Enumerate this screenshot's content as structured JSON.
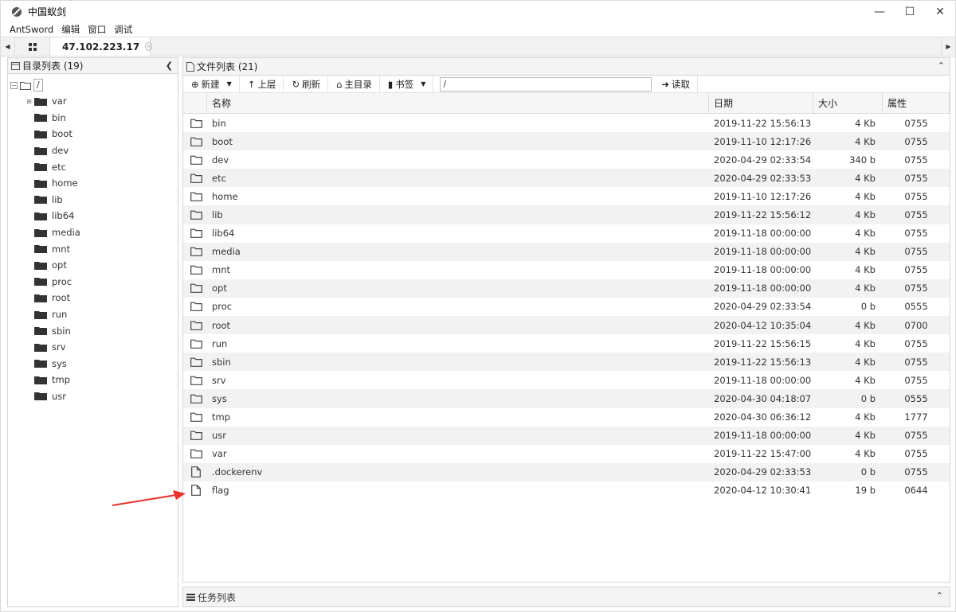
{
  "window": {
    "title": "中国蚁剑",
    "controls": {
      "minimize": "—",
      "maximize": "☐",
      "close": "✕"
    }
  },
  "menu": [
    "AntSword",
    "编辑",
    "窗口",
    "调试"
  ],
  "tabs": {
    "active_label": "47.102.223.17"
  },
  "left_panel": {
    "title": "目录列表 (19)",
    "root_label": "/",
    "items": [
      {
        "name": "var",
        "expandable": true
      },
      {
        "name": "bin"
      },
      {
        "name": "boot"
      },
      {
        "name": "dev"
      },
      {
        "name": "etc"
      },
      {
        "name": "home"
      },
      {
        "name": "lib"
      },
      {
        "name": "lib64"
      },
      {
        "name": "media"
      },
      {
        "name": "mnt"
      },
      {
        "name": "opt"
      },
      {
        "name": "proc"
      },
      {
        "name": "root"
      },
      {
        "name": "run"
      },
      {
        "name": "sbin"
      },
      {
        "name": "srv"
      },
      {
        "name": "sys"
      },
      {
        "name": "tmp"
      },
      {
        "name": "usr"
      }
    ]
  },
  "right_panel": {
    "title": "文件列表 (21)",
    "toolbar": {
      "new_label": "新建",
      "up_label": "上层",
      "refresh_label": "刷新",
      "home_label": "主目录",
      "bookmark_label": "书签",
      "path_value": "/",
      "read_label": "读取"
    },
    "columns": {
      "name": "名称",
      "date": "日期",
      "size": "大小",
      "attr": "属性"
    },
    "files": [
      {
        "type": "folder",
        "name": "bin",
        "date": "2019-11-22 15:56:13",
        "size": "4 Kb",
        "attr": "0755"
      },
      {
        "type": "folder",
        "name": "boot",
        "date": "2019-11-10 12:17:26",
        "size": "4 Kb",
        "attr": "0755"
      },
      {
        "type": "folder",
        "name": "dev",
        "date": "2020-04-29 02:33:54",
        "size": "340 b",
        "attr": "0755"
      },
      {
        "type": "folder",
        "name": "etc",
        "date": "2020-04-29 02:33:53",
        "size": "4 Kb",
        "attr": "0755"
      },
      {
        "type": "folder",
        "name": "home",
        "date": "2019-11-10 12:17:26",
        "size": "4 Kb",
        "attr": "0755"
      },
      {
        "type": "folder",
        "name": "lib",
        "date": "2019-11-22 15:56:12",
        "size": "4 Kb",
        "attr": "0755"
      },
      {
        "type": "folder",
        "name": "lib64",
        "date": "2019-11-18 00:00:00",
        "size": "4 Kb",
        "attr": "0755"
      },
      {
        "type": "folder",
        "name": "media",
        "date": "2019-11-18 00:00:00",
        "size": "4 Kb",
        "attr": "0755"
      },
      {
        "type": "folder",
        "name": "mnt",
        "date": "2019-11-18 00:00:00",
        "size": "4 Kb",
        "attr": "0755"
      },
      {
        "type": "folder",
        "name": "opt",
        "date": "2019-11-18 00:00:00",
        "size": "4 Kb",
        "attr": "0755"
      },
      {
        "type": "folder",
        "name": "proc",
        "date": "2020-04-29 02:33:54",
        "size": "0 b",
        "attr": "0555"
      },
      {
        "type": "folder",
        "name": "root",
        "date": "2020-04-12 10:35:04",
        "size": "4 Kb",
        "attr": "0700"
      },
      {
        "type": "folder",
        "name": "run",
        "date": "2019-11-22 15:56:15",
        "size": "4 Kb",
        "attr": "0755"
      },
      {
        "type": "folder",
        "name": "sbin",
        "date": "2019-11-22 15:56:13",
        "size": "4 Kb",
        "attr": "0755"
      },
      {
        "type": "folder",
        "name": "srv",
        "date": "2019-11-18 00:00:00",
        "size": "4 Kb",
        "attr": "0755"
      },
      {
        "type": "folder",
        "name": "sys",
        "date": "2020-04-30 04:18:07",
        "size": "0 b",
        "attr": "0555"
      },
      {
        "type": "folder",
        "name": "tmp",
        "date": "2020-04-30 06:36:12",
        "size": "4 Kb",
        "attr": "1777"
      },
      {
        "type": "folder",
        "name": "usr",
        "date": "2019-11-18 00:00:00",
        "size": "4 Kb",
        "attr": "0755"
      },
      {
        "type": "folder",
        "name": "var",
        "date": "2019-11-22 15:47:00",
        "size": "4 Kb",
        "attr": "0755"
      },
      {
        "type": "file",
        "name": ".dockerenv",
        "date": "2020-04-29 02:33:53",
        "size": "0 b",
        "attr": "0755"
      },
      {
        "type": "file",
        "name": "flag",
        "date": "2020-04-12 10:30:41",
        "size": "19 b",
        "attr": "0644"
      }
    ]
  },
  "task_panel": {
    "title": "任务列表"
  },
  "annotation": {
    "arrow_color": "#e8332a"
  }
}
